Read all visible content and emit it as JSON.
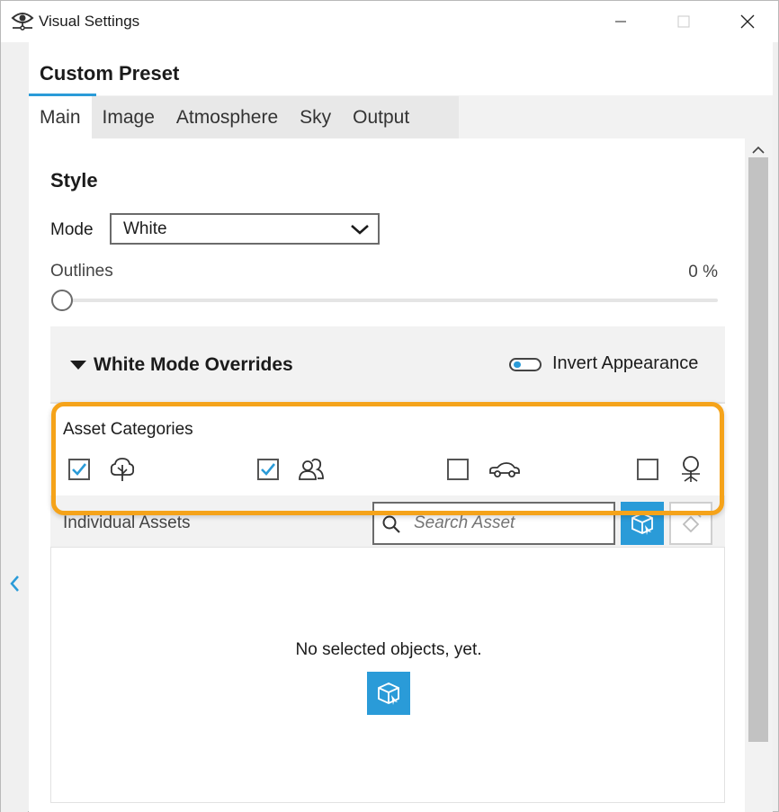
{
  "window": {
    "title": "Visual Settings",
    "icon": "eye-icon",
    "controls": [
      "minimize-icon",
      "maximize-icon",
      "close-icon"
    ]
  },
  "preset": {
    "title": "Custom Preset"
  },
  "tabs": [
    {
      "label": "Main",
      "active": true
    },
    {
      "label": "Image",
      "active": false
    },
    {
      "label": "Atmosphere",
      "active": false
    },
    {
      "label": "Sky",
      "active": false
    },
    {
      "label": "Output",
      "active": false
    }
  ],
  "style": {
    "title": "Style",
    "mode_label": "Mode",
    "mode_value": "White",
    "outlines_label": "Outlines",
    "outlines_value": "0 %",
    "outlines_level": 0
  },
  "overrides": {
    "title": "White Mode Overrides",
    "invert_label": "Invert Appearance",
    "invert_on": false,
    "asset_categories_label": "Asset Categories",
    "categories": [
      {
        "icon": "tree-icon",
        "checked": true
      },
      {
        "icon": "people-icon",
        "checked": true
      },
      {
        "icon": "car-icon",
        "checked": false
      },
      {
        "icon": "office-chair-icon",
        "checked": false
      }
    ],
    "individual_assets_label": "Individual Assets",
    "search_placeholder": "Search Asset",
    "empty_text": "No selected objects, yet."
  },
  "colors": {
    "accent": "#2a9bd8",
    "highlight": "#f5a31a"
  }
}
